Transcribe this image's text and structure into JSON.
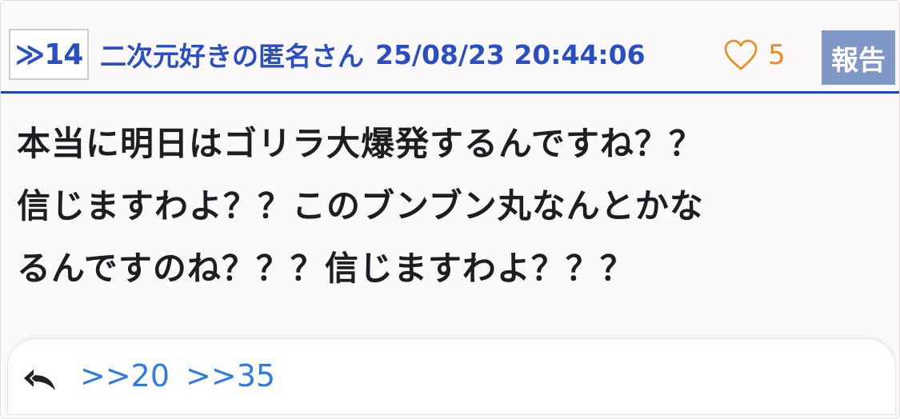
{
  "post": {
    "number": "≫14",
    "author": "二次元好きの匿名さん",
    "datetime": "25/08/23 20:44:06",
    "like_count": "5",
    "report_label": "報告",
    "body_lines": [
      "本当に明日はゴリラ大爆発するんですね？？",
      "信じますわよ？？このブンブン丸なんとかな",
      "るんですのね？？？信じますわよ？？？"
    ],
    "replies": [
      ">>20",
      ">>35"
    ]
  },
  "icons": {
    "like": "heart-outline-icon",
    "reply": "reply-arrow-icon"
  },
  "colors": {
    "accent_blue": "#2a4fc3",
    "like_orange": "#ee8a1c",
    "report_bg": "#7f98c8",
    "link_blue": "#2f7be0"
  }
}
